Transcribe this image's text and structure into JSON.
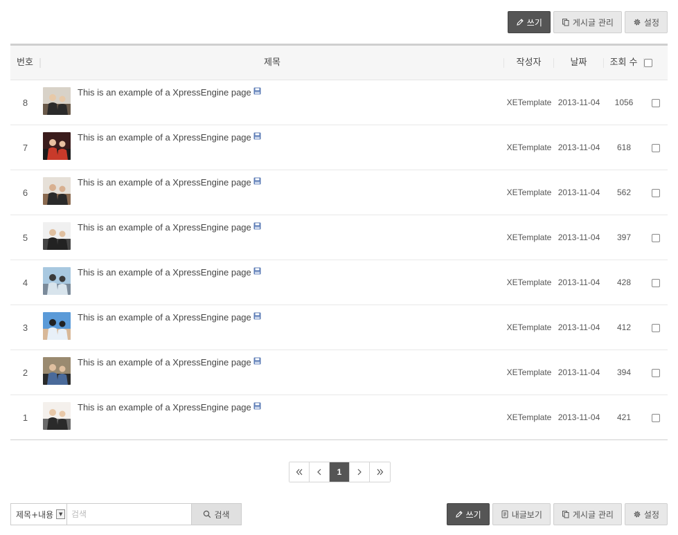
{
  "toolbar_top": {
    "write_label": "쓰기",
    "manage_label": "게시글 관리",
    "settings_label": "설정"
  },
  "table": {
    "headers": {
      "no": "번호",
      "title": "제목",
      "author": "작성자",
      "date": "날짜",
      "views": "조회 수"
    },
    "rows": [
      {
        "no": "8",
        "title": "This is an example of a XpressEngine page",
        "author": "XETemplate",
        "date": "2013-11-04",
        "views": "1056"
      },
      {
        "no": "7",
        "title": "This is an example of a XpressEngine page",
        "author": "XETemplate",
        "date": "2013-11-04",
        "views": "618"
      },
      {
        "no": "6",
        "title": "This is an example of a XpressEngine page",
        "author": "XETemplate",
        "date": "2013-11-04",
        "views": "562"
      },
      {
        "no": "5",
        "title": "This is an example of a XpressEngine page",
        "author": "XETemplate",
        "date": "2013-11-04",
        "views": "397"
      },
      {
        "no": "4",
        "title": "This is an example of a XpressEngine page",
        "author": "XETemplate",
        "date": "2013-11-04",
        "views": "428"
      },
      {
        "no": "3",
        "title": "This is an example of a XpressEngine page",
        "author": "XETemplate",
        "date": "2013-11-04",
        "views": "412"
      },
      {
        "no": "2",
        "title": "This is an example of a XpressEngine page",
        "author": "XETemplate",
        "date": "2013-11-04",
        "views": "394"
      },
      {
        "no": "1",
        "title": "This is an example of a XpressEngine page",
        "author": "XETemplate",
        "date": "2013-11-04",
        "views": "421"
      }
    ]
  },
  "pagination": {
    "current": "1"
  },
  "search": {
    "scope": "제목+내용",
    "placeholder": "검색",
    "button_label": "검색"
  },
  "toolbar_bottom": {
    "write_label": "쓰기",
    "mylist_label": "내글보기",
    "manage_label": "게시글 관리",
    "settings_label": "설정"
  },
  "colors": {
    "primary_button": "#555555",
    "default_button": "#e8e8e8",
    "header_bg": "#f6f6f6",
    "save_icon": "#5b7bb5"
  }
}
